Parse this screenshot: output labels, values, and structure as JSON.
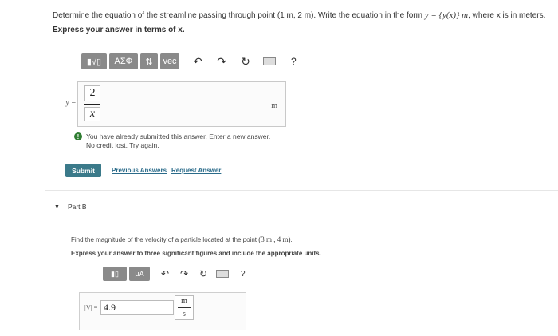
{
  "partA": {
    "question_prefix": "Determine the equation of the streamline passing through point (1 m, 2 m). Write the equation in the form ",
    "question_math": "y = {y(x)} m",
    "question_suffix": ", where x is in meters.",
    "express": "Express your answer in terms of x.",
    "toolbar": {
      "template_btn": "▮√▯",
      "greek_btn": "ΑΣΦ",
      "arrows_btn": "⇅",
      "vec_btn": "vec",
      "help": "?"
    },
    "y_label": "y =",
    "answer_numerator": "2",
    "answer_denominator": "x",
    "unit": "m",
    "feedback_line1": "You have already submitted this answer. Enter a new answer.",
    "feedback_line2": "No credit lost. Try again.",
    "submit_label": "Submit",
    "previous_answers": "Previous Answers",
    "request_answer": "Request Answer"
  },
  "partB": {
    "title": "Part B",
    "question_prefix": "Find the magnitude of the velocity of a particle located at the point ",
    "question_math": "(3 m , 4 m)",
    "question_suffix": ".",
    "express": "Express your answer to three significant figures and include the appropriate units.",
    "toolbar": {
      "template_btn": "▮▯",
      "units_btn": "μA",
      "help": "?"
    },
    "v_label": "|V| =",
    "v_value": "4.9",
    "unit_num": "m",
    "unit_den": "s"
  },
  "colors": {
    "submit": "#3b7a8a",
    "link": "#2a6b8a",
    "alert": "#2f7d32",
    "toolbar_btn": "#8a8a8a"
  }
}
